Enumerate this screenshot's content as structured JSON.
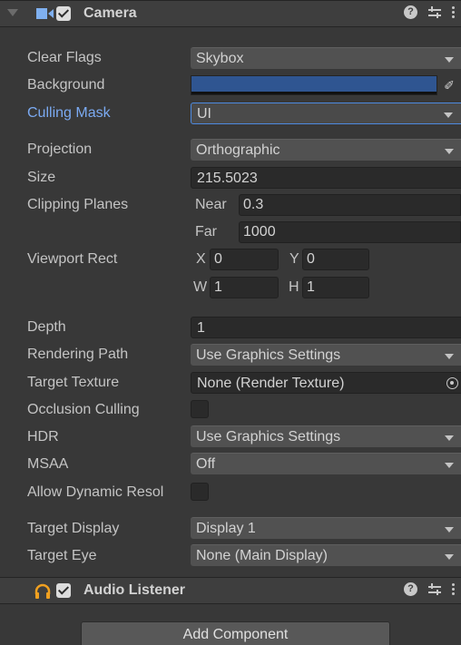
{
  "camera": {
    "title": "Camera",
    "enabled": true,
    "fields": {
      "clear_flags": {
        "label": "Clear Flags",
        "value": "Skybox"
      },
      "background": {
        "label": "Background",
        "color": "#2f5591"
      },
      "culling_mask": {
        "label": "Culling Mask",
        "value": "UI"
      },
      "projection": {
        "label": "Projection",
        "value": "Orthographic"
      },
      "size": {
        "label": "Size",
        "value": "215.5023"
      },
      "clipping_planes": {
        "label": "Clipping Planes",
        "near_label": "Near",
        "near_value": "0.3",
        "far_label": "Far",
        "far_value": "1000"
      },
      "viewport_rect": {
        "label": "Viewport Rect",
        "x_label": "X",
        "x": "0",
        "y_label": "Y",
        "y": "0",
        "w_label": "W",
        "w": "1",
        "h_label": "H",
        "h": "1"
      },
      "depth": {
        "label": "Depth",
        "value": "1"
      },
      "rendering_path": {
        "label": "Rendering Path",
        "value": "Use Graphics Settings"
      },
      "target_texture": {
        "label": "Target Texture",
        "value": "None (Render Texture)"
      },
      "occlusion_culling": {
        "label": "Occlusion Culling",
        "checked": false
      },
      "hdr": {
        "label": "HDR",
        "value": "Use Graphics Settings"
      },
      "msaa": {
        "label": "MSAA",
        "value": "Off"
      },
      "allow_dynamic_resolution": {
        "label": "Allow Dynamic Resol",
        "checked": false
      },
      "target_display": {
        "label": "Target Display",
        "value": "Display 1"
      },
      "target_eye": {
        "label": "Target Eye",
        "value": "None (Main Display)"
      }
    }
  },
  "audio_listener": {
    "title": "Audio Listener",
    "enabled": true
  },
  "add_component": {
    "label": "Add Component"
  },
  "icons": {
    "help": "?",
    "picker": "✐"
  }
}
